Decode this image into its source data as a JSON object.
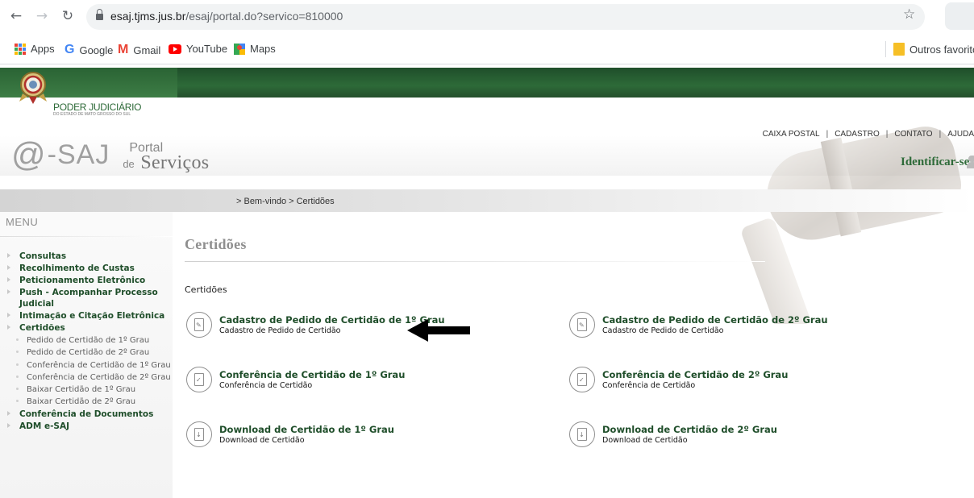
{
  "browser": {
    "url_host": "esaj.tjms.jus.br",
    "url_path": "/esaj/portal.do?servico=810000",
    "bookmarks": [
      "Apps",
      "Google",
      "Gmail",
      "YouTube",
      "Maps"
    ],
    "other_bookmarks": "Outros favoritos",
    "icons": [
      "back-arrow-icon",
      "forward-arrow-icon",
      "reload-icon",
      "lock-icon",
      "star-icon"
    ]
  },
  "site": {
    "institution_title": "PODER JUDICIÁRIO",
    "institution_subtitle": "DO ESTADO DE MATO GROSSO DO SUL",
    "logo": {
      "at": "@",
      "saj": "-SAJ",
      "portal": "Portal",
      "de": "de",
      "servicos": "Serviços"
    },
    "top_links": [
      "CAIXA POSTAL",
      "CADASTRO",
      "CONTATO",
      "AJUDA"
    ],
    "link_separator": "|",
    "identify": "Identificar-se",
    "breadcrumb": "> Bem-vindo > Certidões",
    "colors": {
      "brand_green": "#2d6a38",
      "link_green": "#1f4e2a"
    }
  },
  "menu": {
    "title": "MENU",
    "items": [
      {
        "label": "Consultas",
        "level": "top"
      },
      {
        "label": "Recolhimento de Custas",
        "level": "top"
      },
      {
        "label": "Peticionamento Eletrônico",
        "level": "top"
      },
      {
        "label": "Push - Acompanhar Processo Judicial",
        "level": "top"
      },
      {
        "label": "Intimação e Citação Eletrônica",
        "level": "top"
      },
      {
        "label": "Certidões",
        "level": "top"
      },
      {
        "label": "Pedido de Certidão de 1º Grau",
        "level": "sub"
      },
      {
        "label": "Pedido de Certidão de 2º Grau",
        "level": "sub"
      },
      {
        "label": "Conferência de Certidão de 1º Grau",
        "level": "sub"
      },
      {
        "label": "Conferência de Certidão de 2º Grau",
        "level": "sub"
      },
      {
        "label": "Baixar Certidão de 1º Grau",
        "level": "sub"
      },
      {
        "label": "Baixar Certidão de 2º Grau",
        "level": "sub"
      },
      {
        "label": "Conferência de Documentos",
        "level": "top"
      },
      {
        "label": "ADM e-SAJ",
        "level": "top"
      }
    ]
  },
  "main": {
    "page_title": "Certidões",
    "section_label": "Certidões",
    "cards": [
      {
        "title": "Cadastro de Pedido de Certidão de 1º Grau",
        "desc": "Cadastro de Pedido de Certidão",
        "icon": "request-document-icon"
      },
      {
        "title": "Cadastro de Pedido de Certidão de 2º Grau",
        "desc": "Cadastro de Pedido de Certidão",
        "icon": "request-document-icon"
      },
      {
        "title": "Conferência de Certidão de 1º Grau",
        "desc": "Conferência de Certidão",
        "icon": "verify-document-icon"
      },
      {
        "title": "Conferência de Certidão de 2º Grau",
        "desc": "Conferência de Certidão",
        "icon": "verify-document-icon"
      },
      {
        "title": "Download de Certidão de 1º Grau",
        "desc": "Download de Certidão",
        "icon": "download-document-icon"
      },
      {
        "title": "Download de Certidão de 2º Grau",
        "desc": "Download de Certidão",
        "icon": "download-document-icon"
      }
    ]
  }
}
